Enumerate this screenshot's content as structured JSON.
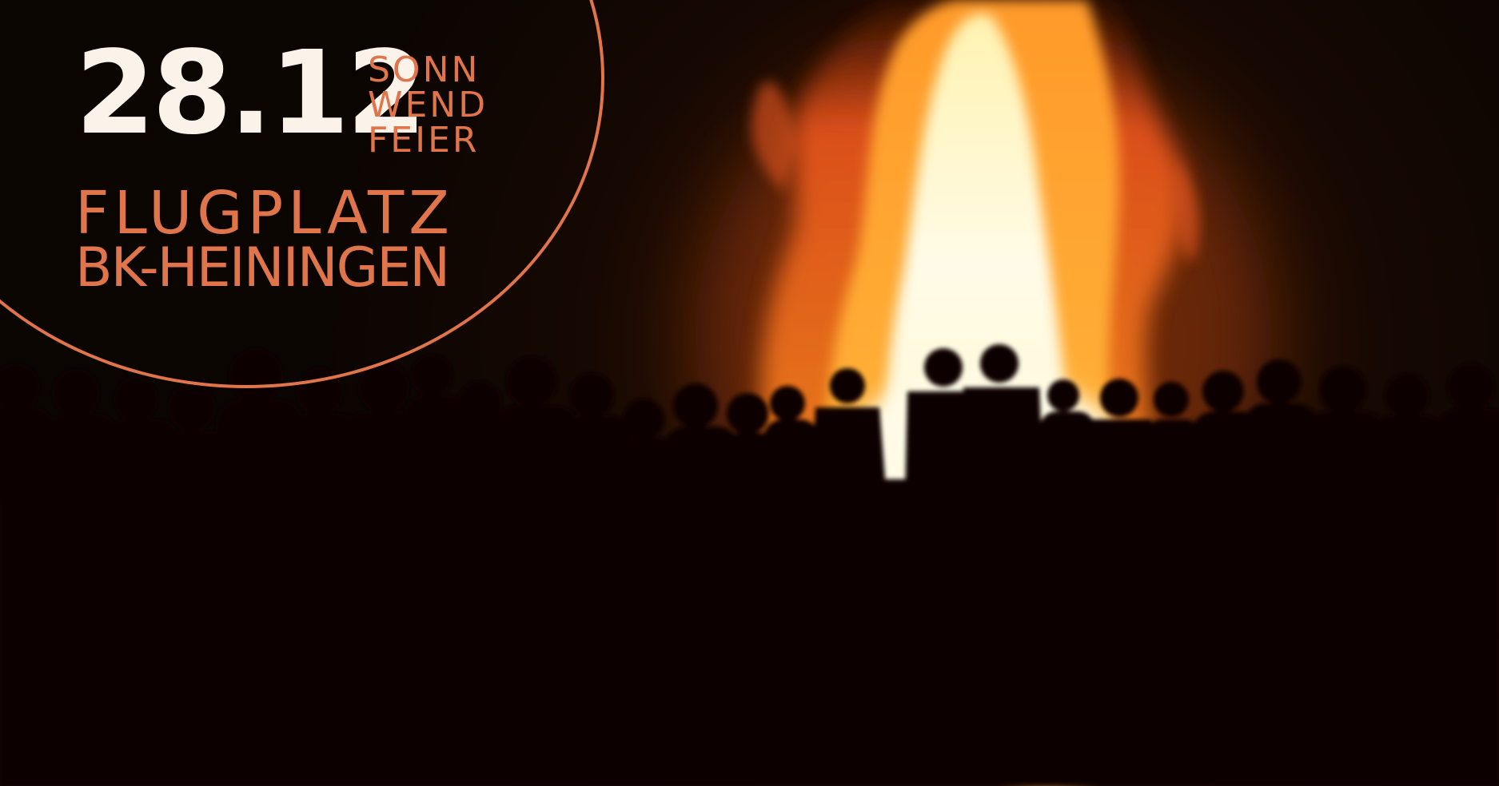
{
  "event": {
    "date": "28.12",
    "name_lines": [
      "SONN",
      "WEND",
      "FEIER"
    ],
    "location_lines": [
      "FLUGPLATZ",
      "BK-HEININGEN"
    ]
  },
  "photo": {
    "subject": "bonfire-with-silhouetted-crowd"
  },
  "colors": {
    "accent": "#e0744a",
    "date_text": "#fbf3e9",
    "background": "#0b0502",
    "fire_core": "#fffbe6",
    "fire_mid": "#ffb43a",
    "fire_outer": "#e8541c",
    "silhouette": "#0a0503"
  }
}
